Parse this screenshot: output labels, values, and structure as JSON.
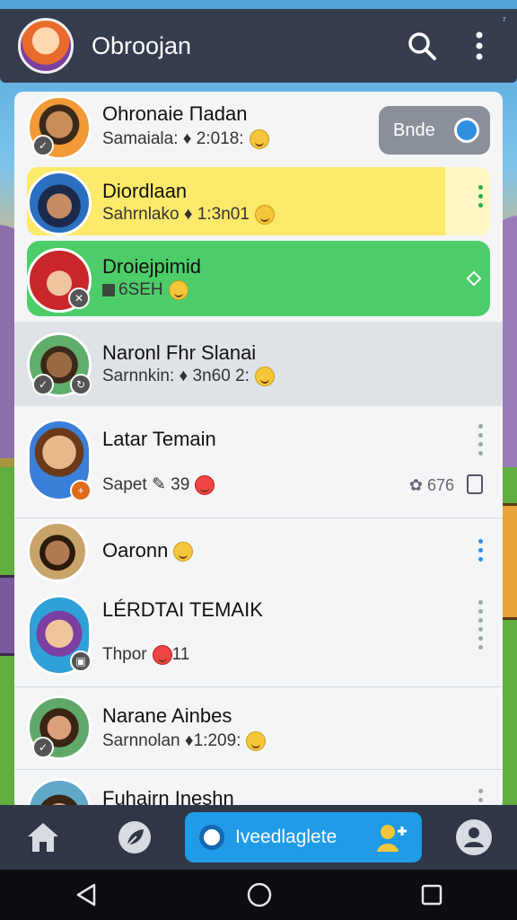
{
  "app": {
    "title": "Obroojan",
    "corner_mark": "⁷"
  },
  "header_actions": {
    "search_icon": "search-icon",
    "more_icon": "more-vert-icon"
  },
  "chats": [
    {
      "name": "Ohronaie Πadan",
      "subtitle": "Samaiala: ♦ 2:018:",
      "action_button": "Bnde"
    },
    {
      "name": "Diordlaan",
      "subtitle": "Sahrnlako ♦ 1:3n01",
      "highlight": "#fde96a"
    },
    {
      "name": "Droiejpimid",
      "subtitle": "6SEH",
      "highlight": "#4dcd6a"
    },
    {
      "name": "Naronl Fhr Slanai",
      "subtitle": "Sarnnkin: ♦ 3n60 2:",
      "highlight": "#dfe2e6"
    },
    {
      "name": "Latar Temain",
      "subtitle": "Sapet",
      "subtitle_extra": "39",
      "meta": "676"
    },
    {
      "name": "Oaronn",
      "subtitle": ""
    },
    {
      "name": "LÉRDTAI TEMAIK",
      "subtitle": "Thpor",
      "subtitle_extra": "11"
    },
    {
      "name": "Narane Ainbes",
      "subtitle": "Sarnnolan ♦1:209:"
    },
    {
      "name": "Fuhairn Ineshn",
      "subtitle": ""
    }
  ],
  "bottom_nav": {
    "home_icon": "home-icon",
    "leaf_icon": "leaf-icon",
    "cta_label": "Iveedlaglete",
    "profile_icon": "profile-icon"
  },
  "colors": {
    "appbar": "#353d4e",
    "accent": "#1f9be8",
    "yellow_row": "#fde96a",
    "green_row": "#4dcd6a"
  }
}
